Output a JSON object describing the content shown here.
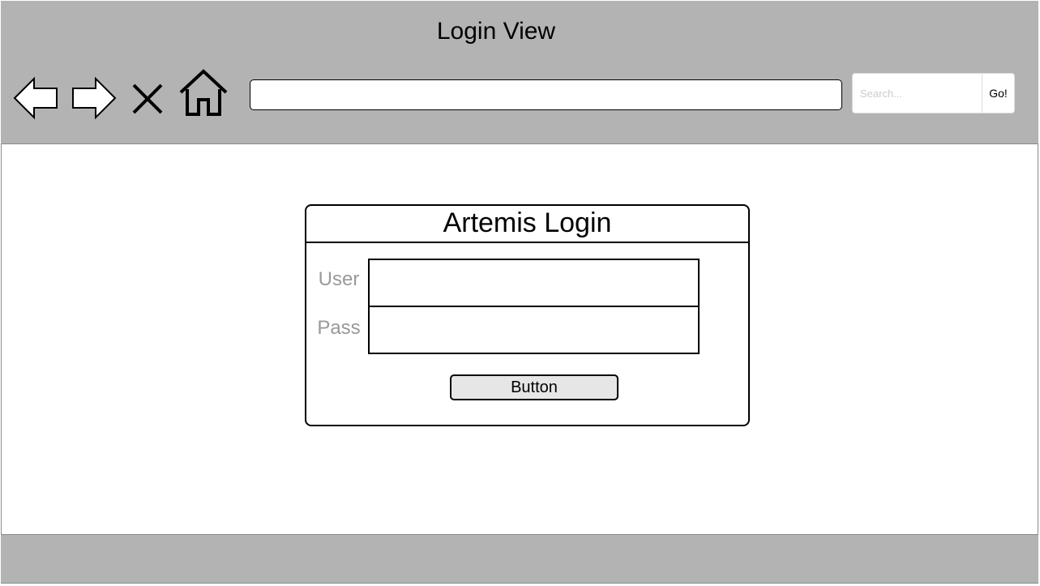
{
  "window": {
    "title": "Login View"
  },
  "toolbar": {
    "icons": [
      "back-arrow-icon",
      "forward-arrow-icon",
      "close-icon",
      "home-icon"
    ],
    "address_value": ""
  },
  "search": {
    "placeholder": "Search...",
    "button_label": "Go!"
  },
  "login": {
    "title": "Artemis Login",
    "user_label": "User",
    "pass_label": "Pass",
    "user_value": "",
    "pass_value": "",
    "button_label": "Button"
  },
  "colors": {
    "chrome_gray": "#b3b3b3",
    "label_gray": "#999999",
    "button_fill": "#e6e6e6"
  }
}
